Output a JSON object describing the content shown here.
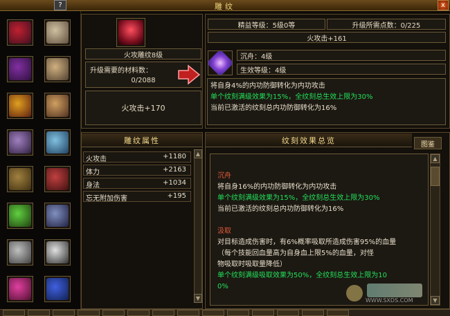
{
  "window": {
    "title": "雕纹",
    "help": "?",
    "close": "x"
  },
  "slots": [
    {
      "icon": "red-crystal-icon"
    },
    {
      "icon": "ring-icon"
    },
    {
      "icon": "armor-icon"
    },
    {
      "icon": "ring-icon"
    },
    {
      "icon": "boots-gold-icon"
    },
    {
      "icon": "bracer-icon"
    },
    {
      "icon": "emblem-icon"
    },
    {
      "icon": "sword-icon"
    },
    {
      "icon": "belt-icon"
    },
    {
      "icon": "gauntlet-icon"
    },
    {
      "icon": "green-flower-icon"
    },
    {
      "icon": "leg-guard-icon"
    },
    {
      "icon": "necklace-icon"
    },
    {
      "icon": "pendant-icon"
    },
    {
      "icon": "amulet-icon"
    },
    {
      "icon": "blue-gem-icon"
    }
  ],
  "upgrade": {
    "item_name": "火攻雕纹8级",
    "material_label": "升级需要的材料数：",
    "material_value": "0/2088",
    "current_effect": "火攻击+170"
  },
  "detail": {
    "level_label": "精益等级：5级0等",
    "points_label": "升级所需点数：0/225",
    "next_effect": "火攻击+161",
    "rune_name": "沉舟：4级",
    "effect_level": "生效等级：4级",
    "desc_lines": [
      {
        "text": "将自身4%的内功防御转化为内功攻击",
        "color": "white"
      },
      {
        "text": "单个纹刻满级效果为15%，全纹刻总生效上限为30%",
        "color": "green"
      },
      {
        "text": "当前已激活的纹刻总内功防御转化为16%",
        "color": "white"
      }
    ]
  },
  "attributes": {
    "title": "雕纹属性",
    "rows": [
      {
        "name": "火攻击",
        "value": "+1180"
      },
      {
        "name": "体力",
        "value": "+2163"
      },
      {
        "name": "身法",
        "value": "+1034"
      },
      {
        "name": "忘无附加伤害",
        "value": "+195"
      }
    ]
  },
  "overview": {
    "title": "纹刻效果总览",
    "catalog_button": "图鉴",
    "lines": [
      {
        "text": "沉舟",
        "color": "red"
      },
      {
        "text": "将自身16%的内功防御转化为内功攻击",
        "color": "white"
      },
      {
        "text": "单个纹刻满级效果为15%，全纹刻总生效上限为30%",
        "color": "green"
      },
      {
        "text": "当前已激活的纹刻总内功防御转化为16%",
        "color": "white"
      },
      {
        "text": "",
        "color": "white"
      },
      {
        "text": "汲取",
        "color": "red"
      },
      {
        "text": "对目标造成伤害时，有6%概率吸取所造成伤害95%的血量",
        "color": "white"
      },
      {
        "text": "（每个技能回血量高为自身血上限5%的血量，对怪",
        "color": "white"
      },
      {
        "text": "物吸取时吸取量降低）",
        "color": "white"
      },
      {
        "text": "单个纹刻满级吸取效果为50%，全纹刻总生效上限为10",
        "color": "green"
      },
      {
        "text": "0%",
        "color": "green"
      }
    ]
  },
  "watermark": {
    "site": "WWW.SXDS.COM"
  }
}
